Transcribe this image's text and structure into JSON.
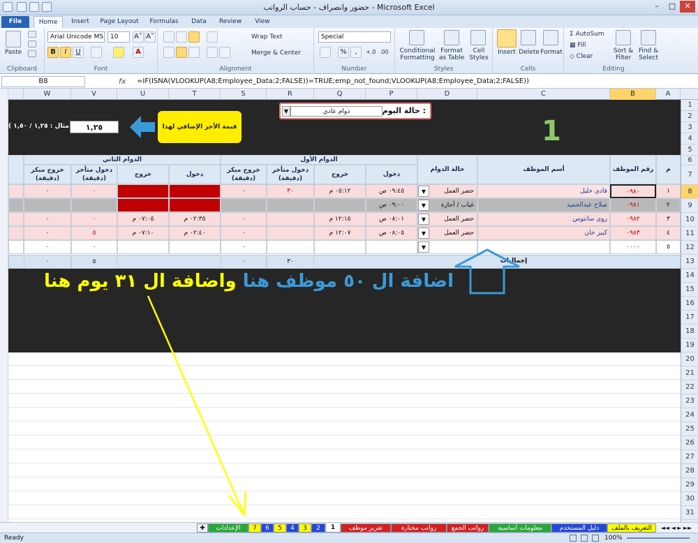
{
  "window": {
    "title": "حضور وانصراف - حساب الرواتب - Microsoft Excel",
    "min": "–",
    "max": "□",
    "close": "✕"
  },
  "ribbon_tabs": [
    "File",
    "Home",
    "Insert",
    "Page Layout",
    "Formulas",
    "Data",
    "Review",
    "View"
  ],
  "ribbon": {
    "clipboard": {
      "paste": "Paste",
      "label": "Clipboard"
    },
    "font": {
      "name": "Arial Unicode MS",
      "size": "10",
      "bold": "B",
      "italic": "I",
      "underline": "U",
      "label": "Font",
      "grow": "A˄",
      "shrink": "A˅"
    },
    "alignment": {
      "wrap": "Wrap Text",
      "merge": "Merge & Center",
      "label": "Alignment"
    },
    "number": {
      "format": "Special",
      "label": "Number",
      "pct": "%",
      "comma": ",",
      "inc": "+.0",
      "dec": ".00"
    },
    "styles": {
      "cond": "Conditional Formatting",
      "table": "Format as Table",
      "cell": "Cell Styles",
      "label": "Styles"
    },
    "cells": {
      "insert": "Insert",
      "delete": "Delete",
      "format": "Format",
      "label": "Cells"
    },
    "editing": {
      "autosum": "AutoSum",
      "fill": "Fill",
      "clear": "Clear",
      "sort": "Sort & Filter",
      "find": "Find & Select",
      "label": "Editing"
    }
  },
  "formula_bar": {
    "name_box": "B8",
    "fx": "fx",
    "formula": "=IF(ISNA(VLOOKUP(A8;Employee_Data;2;FALSE))=TRUE;emp_not_found;VLOOKUP(A8;Employee_Data;2;FALSE))"
  },
  "columns": [
    "W",
    "V",
    "U",
    "T",
    "S",
    "R",
    "Q",
    "P",
    "D",
    "C",
    "B",
    "A"
  ],
  "rows": [
    "1",
    "2",
    "3",
    "4",
    "5",
    "6",
    "7",
    "8",
    "9",
    "10",
    "11",
    "12",
    "13",
    "14",
    "15",
    "16",
    "17",
    "18",
    "19",
    "20",
    "21",
    "22",
    "23",
    "24",
    "25",
    "26",
    "27",
    "28",
    "29",
    "30",
    "31"
  ],
  "sheet": {
    "day_status_label": "حالة اليوم :",
    "day_status_value": "دوام عادي",
    "big_number": "1",
    "overtime_value": "١,٢٥",
    "example_text": "( مثال : ١,٢٥ / ١,٥٠ )",
    "overtime_label": "قيمة الأجر الإضافي لهذا اليوم",
    "headers": {
      "m": "م",
      "emp_no": "رقم الموظف",
      "emp_name": "أسم الموظف",
      "status": "حالة الدوام",
      "shift1": "الدوام الأول",
      "shift2": "الدوام الثاني",
      "in": "دخول",
      "out": "خروج",
      "late_in": "دخول متأخر (دقيقة)",
      "early_out": "خروج مبكر (دقيقة)"
    },
    "employees": [
      {
        "m": "١",
        "no": "٠٩٨٠",
        "name": "فادي خليل",
        "status": "حضر العمل",
        "in1": "٠٩:٤٥ ص",
        "out1": "٠٥:١٢ م",
        "late1": "٣٠",
        "early1": "٠",
        "in2": "",
        "out2": "",
        "late2": "٠",
        "early2": "٠"
      },
      {
        "m": "٢",
        "no": "٠٩٨١",
        "name": "صلاح عبدالحميد",
        "status": "غياب / أجازة",
        "in1": "٠٩:٠٠ ص",
        "out1": "",
        "late1": "",
        "early1": "",
        "in2": "",
        "out2": "",
        "late2": "",
        "early2": ""
      },
      {
        "m": "٣",
        "no": "٠٩٨٢",
        "name": "روي سانتوس",
        "status": "حضر العمل",
        "in1": "٠٨:٠١ ص",
        "out1": "١٢:١٥ م",
        "late1": "",
        "early1": "٠",
        "in2": "٠٢:٣٥ م",
        "out2": "٠٧:٠٥ م",
        "late2": "٠",
        "early2": "٠"
      },
      {
        "m": "٤",
        "no": "٠٩٨٣",
        "name": "كبير خان",
        "status": "حضر العمل",
        "in1": "٠٨:٠٥ ص",
        "out1": "١٢:٠٧ م",
        "late1": "",
        "early1": "٠",
        "in2": "٠٢:٤٠ م",
        "out2": "٠٧:١٠ م",
        "late2": "٥",
        "early2": "٠"
      },
      {
        "m": "٥",
        "no": "٠٠٠٠",
        "name": "",
        "status": "",
        "in1": "",
        "out1": "",
        "late1": "",
        "early1": "٠",
        "in2": "",
        "out2": "",
        "late2": "٠",
        "early2": "٠"
      }
    ],
    "totals_label": "إجماليات",
    "totals": {
      "late1": "٣٠",
      "early1": "٠",
      "late2": "٥",
      "early2": "٠"
    },
    "annotation_blue": "اضافة ال ٥٠ موظف هنا",
    "annotation_yellow": "واضافة ال ٣١ يوم هنا"
  },
  "sheet_tabs": [
    "التعريف بالملف",
    "دليل المستخدم",
    "معلومات أساسية",
    "رواتب الجمع",
    "رواتب مختارة",
    "تقرير موظف",
    "1",
    "2",
    "3",
    "4",
    "5",
    "6",
    "7",
    "الإعدادات"
  ],
  "status": {
    "ready": "Ready",
    "zoom": "100%"
  },
  "colors": {
    "accent": "#2a64b8",
    "dark": "#262626",
    "red": "#c00000",
    "yellow": "#ffff00",
    "blue": "#3a96d8"
  }
}
